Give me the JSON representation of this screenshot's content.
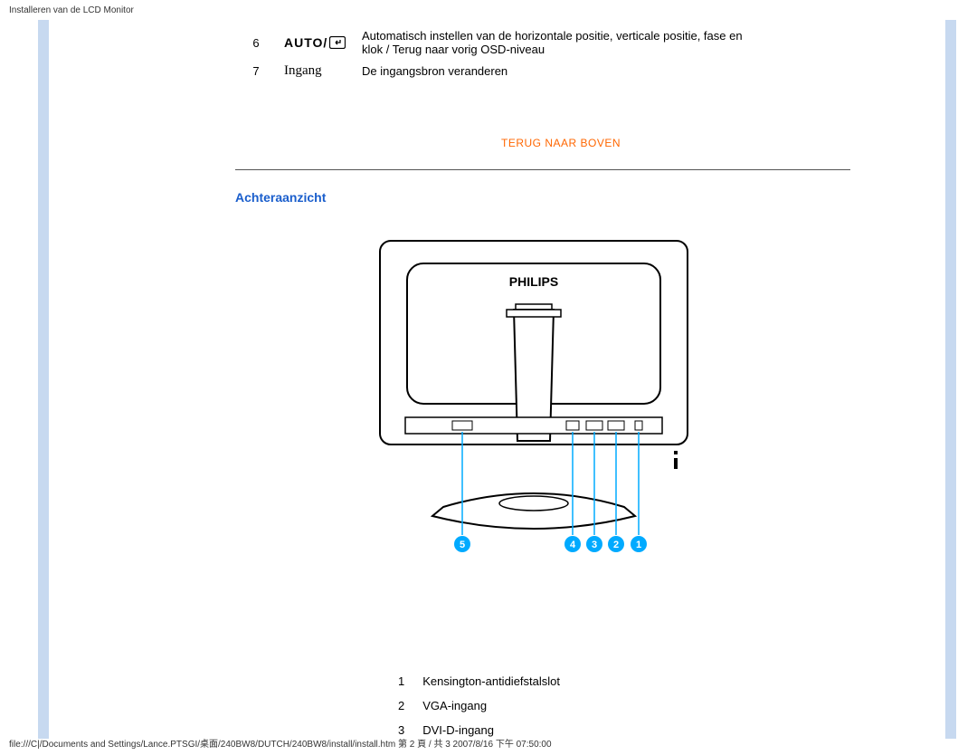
{
  "page_header": "Installeren van de LCD Monitor",
  "page_footer": "file:///C|/Documents and Settings/Lance.PTSGI/桌面/240BW8/DUTCH/240BW8/install/install.htm 第 2 頁 / 共 3 2007/8/16 下午 07:50:00",
  "top_rows": [
    {
      "num": "6",
      "icon": "AUTO/",
      "desc": "Automatisch instellen van de horizontale positie, verticale positie, fase en klok / Terug naar vorig OSD-niveau"
    },
    {
      "num": "7",
      "icon": "Ingang",
      "desc": "De ingangsbron veranderen"
    }
  ],
  "back_to_top": "TERUG NAAR BOVEN",
  "section_heading": "Achteraanzicht",
  "brand_on_monitor": "PHILIPS",
  "callouts": [
    "5",
    "4",
    "3",
    "2",
    "1"
  ],
  "rear_table": [
    {
      "num": "1",
      "desc": "Kensington-antidiefstalslot"
    },
    {
      "num": "2",
      "desc": "VGA-ingang"
    },
    {
      "num": "3",
      "desc": "DVI-D-ingang"
    }
  ]
}
